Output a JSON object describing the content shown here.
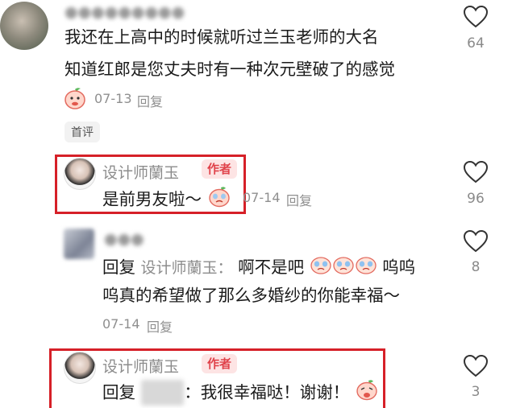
{
  "comments": [
    {
      "text_lines": [
        "我还在上高中的时候就听过兰玉老师的大名",
        "知道红郎是您丈夫时有一种次元壁破了的感觉"
      ],
      "date": "07-13",
      "reply_label": "回复",
      "likes": "64",
      "tag": "首评"
    },
    {
      "name": "设计师蘭玉",
      "badge": "作者",
      "text": "是前男友啦～",
      "date": "07-14",
      "reply_label": "回复",
      "likes": "96"
    },
    {
      "reply_prefix": "回复",
      "reply_to": "设计师蘭玉：",
      "text_a": "啊不是吧",
      "text_b": "呜呜",
      "text_line2": "呜真的希望做了那么多婚纱的你能幸福～",
      "date": "07-14",
      "reply_label": "回复",
      "likes": "8"
    },
    {
      "name": "设计师蘭玉",
      "badge": "作者",
      "reply_prefix": "回复",
      "text": "：我很幸福哒！谢谢！",
      "likes": "3"
    }
  ]
}
